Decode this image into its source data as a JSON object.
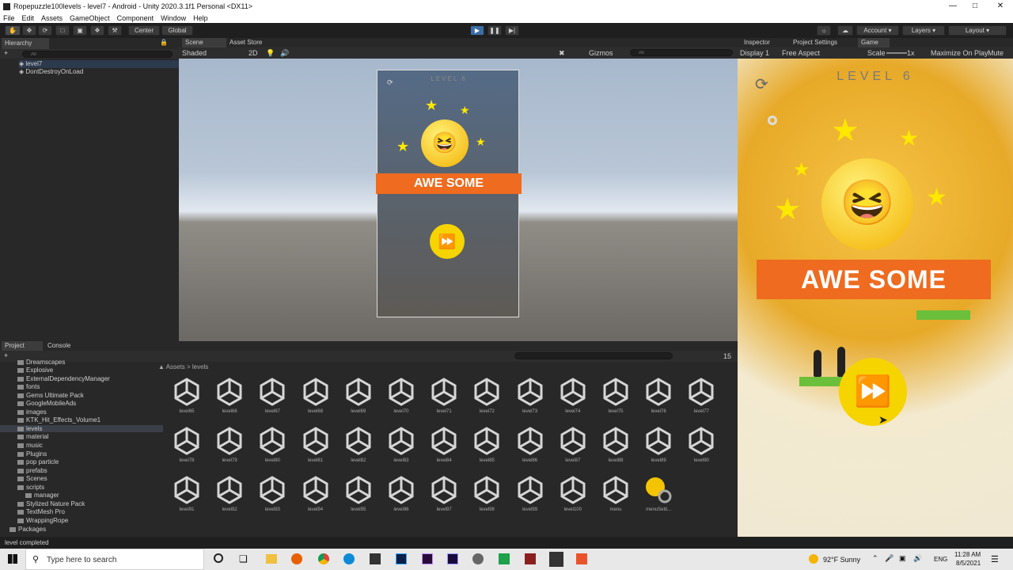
{
  "window": {
    "title": "Ropepuzzle100levels - level7 - Android - Unity 2020.3.1f1 Personal <DX11>"
  },
  "menu": [
    "File",
    "Edit",
    "Assets",
    "GameObject",
    "Component",
    "Window",
    "Help"
  ],
  "toolbar": {
    "center": "Center",
    "global": "Global",
    "account": "Account",
    "layers": "Layers",
    "layout": "Layout"
  },
  "hierarchy": {
    "tab": "Hierarchy",
    "search_placeholder": "All",
    "items": [
      "level7",
      "DontDestroyOnLoad"
    ]
  },
  "scene": {
    "tab_scene": "Scene",
    "tab_asset_store": "Asset Store",
    "shading": "Shaded",
    "mode_2d": "2D",
    "gizmos": "Gizmos",
    "search_placeholder": "All"
  },
  "game_preview_small": {
    "level": "LEVEL 6",
    "banner": "AWE SOME"
  },
  "game": {
    "tab_inspector": "Inspector",
    "tab_project_settings": "Project Settings",
    "tab_game": "Game",
    "display": "Display 1",
    "aspect": "Free Aspect",
    "scale_label": "Scale",
    "scale_value": "1x",
    "maximize": "Maximize On Play",
    "mute": "Mute Au",
    "level": "LEVEL 6",
    "banner": "AWE SOME"
  },
  "project": {
    "tab_project": "Project",
    "tab_console": "Console",
    "breadcrumb": [
      "Assets",
      "levels"
    ],
    "count": "15",
    "folders": [
      "Dreamscapes",
      "Explosive",
      "ExternalDependencyManager",
      "fonts",
      "Gems Ultimate Pack",
      "GoogleMobileAds",
      "images",
      "KTK_Hit_Effects_Volume1",
      "levels",
      "material",
      "music",
      "Plugins",
      "pop particle",
      "prefabs",
      "Scenes",
      "scripts",
      "manager",
      "Stylized Nature Pack",
      "TextMesh Pro",
      "WrappingRope",
      "Packages"
    ],
    "assets": [
      "level65",
      "level66",
      "level67",
      "level68",
      "level69",
      "level70",
      "level71",
      "level72",
      "level73",
      "level74",
      "level75",
      "level76",
      "level77",
      "level78",
      "level79",
      "level80",
      "level81",
      "level82",
      "level83",
      "level84",
      "level85",
      "level86",
      "level87",
      "level88",
      "level89",
      "level90",
      "level91",
      "level92",
      "level93",
      "level94",
      "level95",
      "level96",
      "level97",
      "level98",
      "level99",
      "level100",
      "menu",
      "menuSetti..."
    ]
  },
  "status": {
    "message": "level completed"
  },
  "taskbar": {
    "search_placeholder": "Type here to search",
    "weather": "92°F  Sunny",
    "lang": "ENG",
    "time": "11:28 AM",
    "date": "8/5/2021"
  }
}
